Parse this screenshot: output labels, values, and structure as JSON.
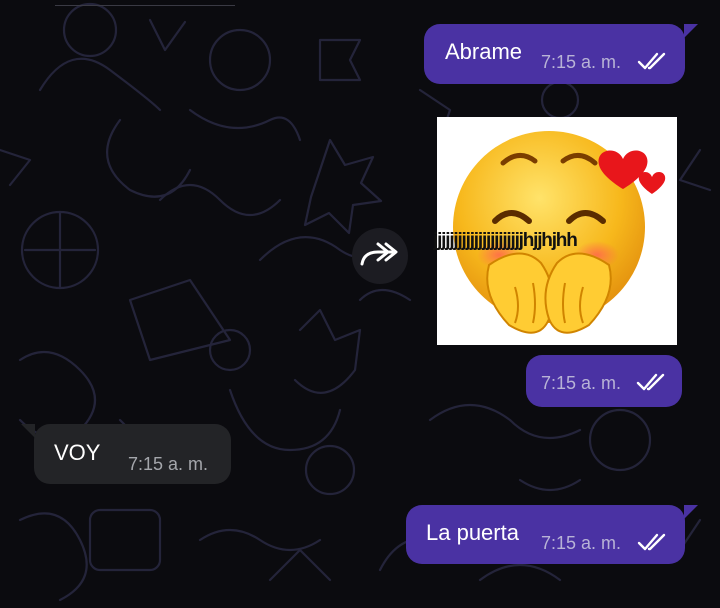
{
  "messages": [
    {
      "kind": "outgoing",
      "text": "Abrame",
      "time": "7:15 a. m.",
      "status": "read"
    },
    {
      "kind": "outgoing-sticker",
      "caption": "jjjjjjjjjjjjjjjjjjjjjjhjjhjhh",
      "time": "7:15 a. m.",
      "status": "read"
    },
    {
      "kind": "incoming",
      "text": "VOY",
      "time": "7:15 a. m."
    },
    {
      "kind": "outgoing",
      "text": "La puerta",
      "time": "7:15 a. m.",
      "status": "read"
    }
  ],
  "icons": {
    "forward": "forward-icon",
    "read_receipt": "double-check-icon",
    "sticker": "blushing-emoji-sticker"
  },
  "colors": {
    "outgoing_bubble": "#4a32a3",
    "incoming_bubble": "#232427",
    "background": "#0b0b0f",
    "ticks": "#ffffff"
  }
}
